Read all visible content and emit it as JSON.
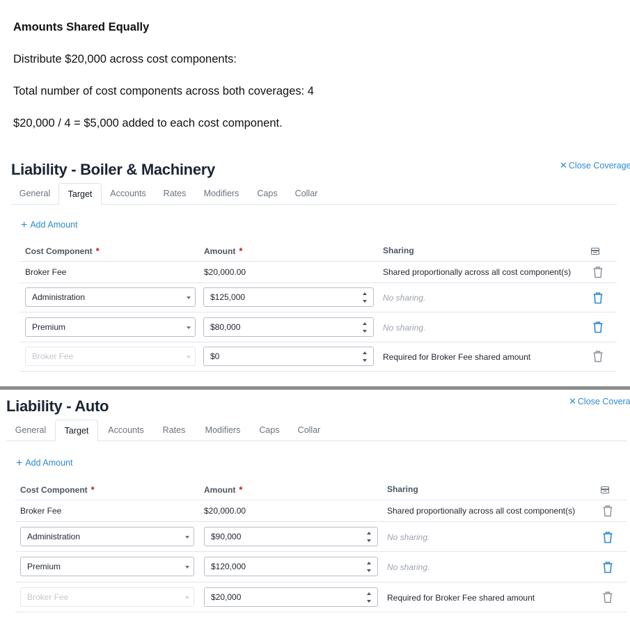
{
  "intro": {
    "heading": "Amounts Shared Equally",
    "line1": "Distribute $20,000 across cost components:",
    "line2": "Total number of cost components across both coverages: 4",
    "line3": "$20,000 / 4 = $5,000 added to each cost component."
  },
  "colors": {
    "accent": "#2e8bd0",
    "delete_active": "#2e8bd0",
    "delete_inactive": "#8a8f98",
    "required": "#b91c1c"
  },
  "panels": [
    {
      "title": "Liability - Boiler & Machinery",
      "close_label": "Close Coverage",
      "tabs": [
        "General",
        "Target",
        "Accounts",
        "Rates",
        "Modifiers",
        "Caps",
        "Collar"
      ],
      "active_tab": "Target",
      "add_amount_label": "Add Amount",
      "headers": {
        "component": "Cost Component",
        "amount": "Amount",
        "sharing": "Sharing",
        "required_mark": "*"
      },
      "rows": [
        {
          "component": "Broker Fee",
          "amount": "$20,000.00",
          "sharing": "Shared proportionally across all cost component(s)"
        },
        {
          "component": "Administration",
          "amount": "$125,000",
          "sharing": "No sharing."
        },
        {
          "component": "Premium",
          "amount": "$80,000",
          "sharing": "No sharing."
        },
        {
          "component": "Broker Fee",
          "amount": "$0",
          "sharing": "Required for Broker Fee shared amount"
        }
      ]
    },
    {
      "title": "Liability - Auto",
      "close_label": "Close Covera",
      "tabs": [
        "General",
        "Target",
        "Accounts",
        "Rates",
        "Modifiers",
        "Caps",
        "Collar"
      ],
      "active_tab": "Target",
      "add_amount_label": "Add Amount",
      "headers": {
        "component": "Cost Component",
        "amount": "Amount",
        "sharing": "Sharing",
        "required_mark": "*"
      },
      "rows": [
        {
          "component": "Broker Fee",
          "amount": "$20,000.00",
          "sharing": "Shared proportionally across all cost component(s)"
        },
        {
          "component": "Administration",
          "amount": "$90,000",
          "sharing": "No sharing."
        },
        {
          "component": "Premium",
          "amount": "$120,000",
          "sharing": "No sharing."
        },
        {
          "component": "Broker Fee",
          "amount": "$20,000",
          "sharing": "Required for Broker Fee shared amount"
        }
      ]
    }
  ]
}
